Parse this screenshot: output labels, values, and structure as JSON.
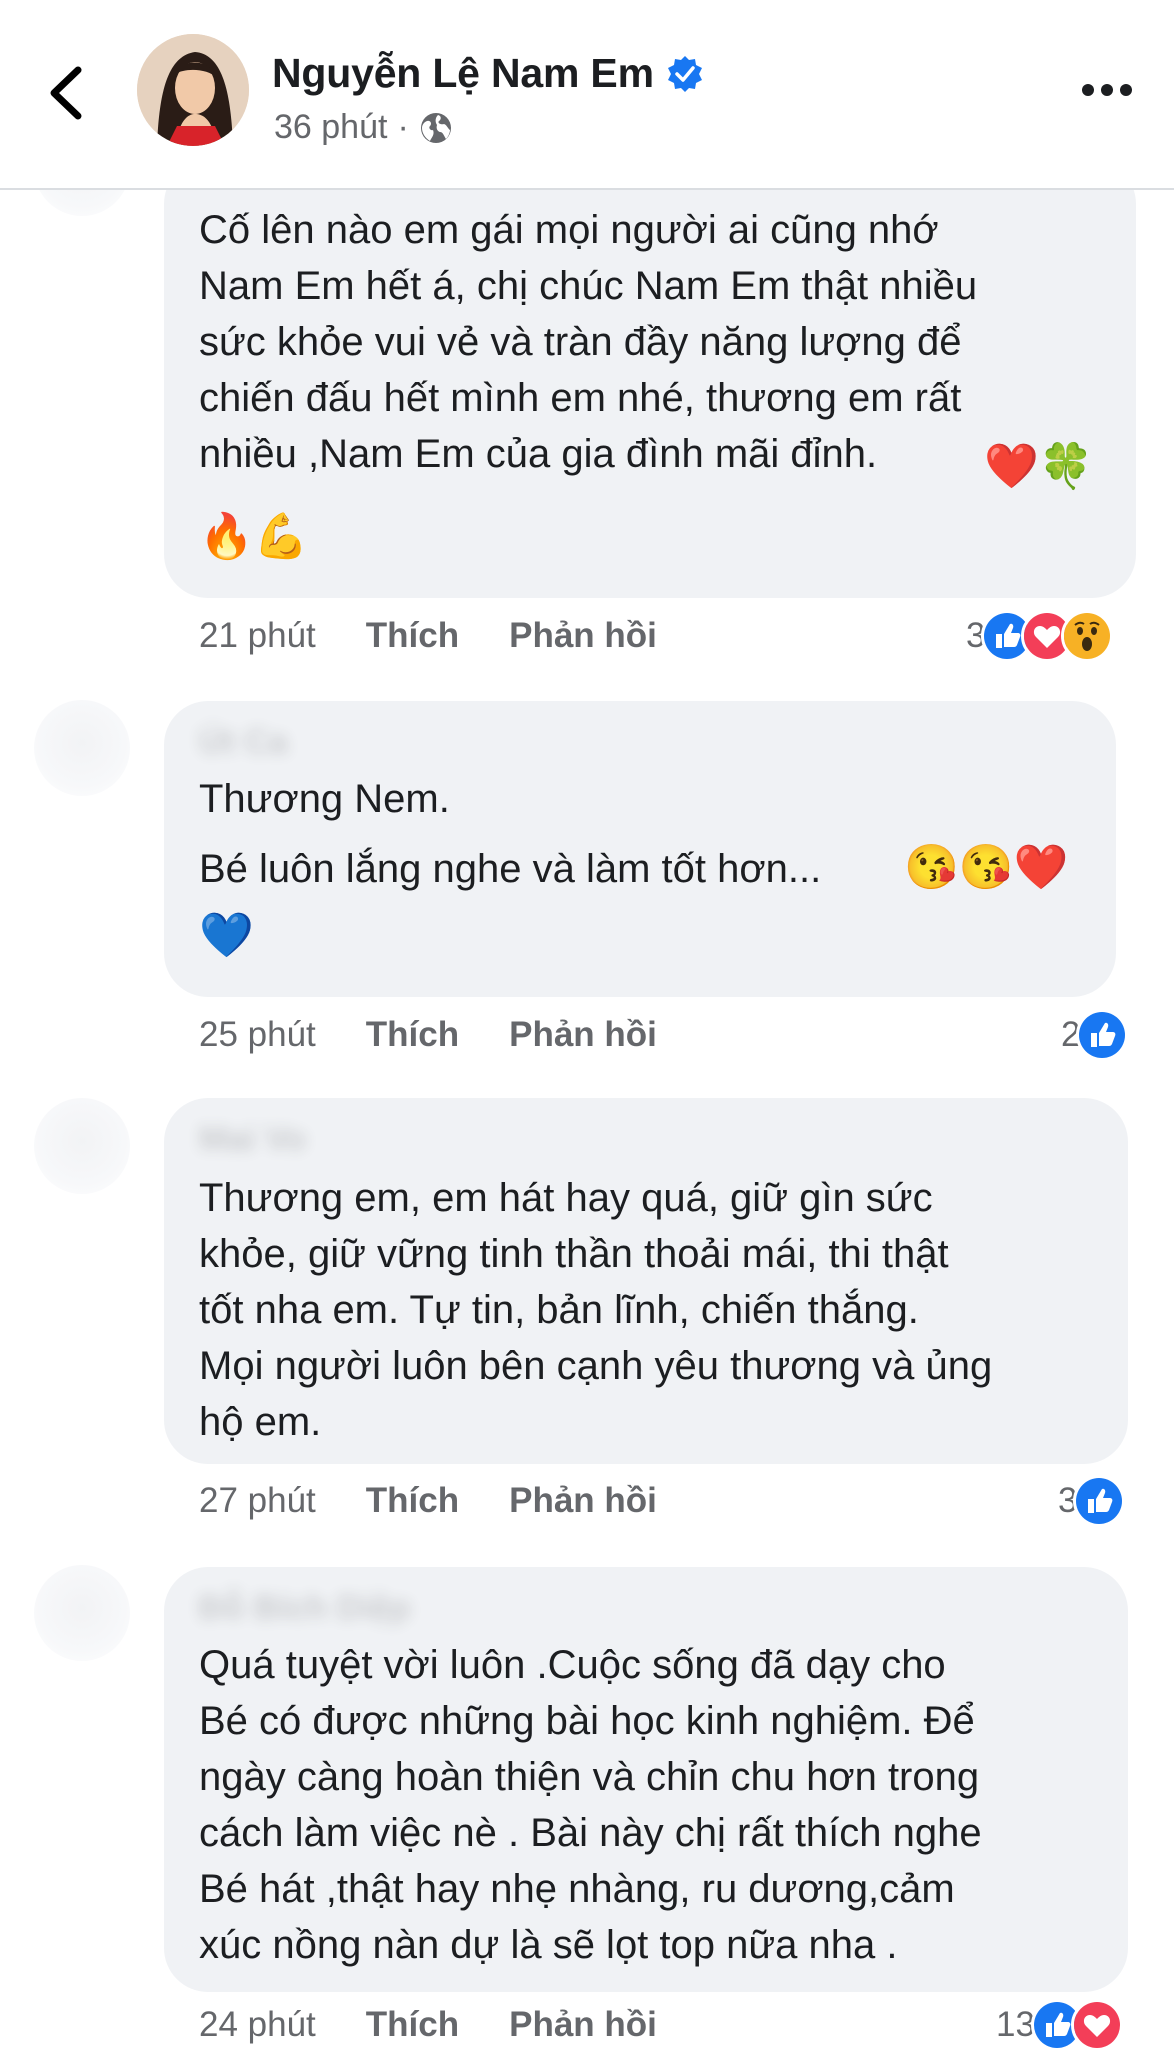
{
  "post": {
    "author": "Nguyễn Lệ Nam Em",
    "time": "36 phút",
    "separator": "·"
  },
  "icons": {
    "back": "chevron-left-icon",
    "verified": "verified-badge-icon",
    "privacy": "globe-icon",
    "more": "more-horizontal-icon"
  },
  "labels": {
    "like": "Thích",
    "reply": "Phản hồi"
  },
  "comments": [
    {
      "text_1": "Cố lên nào em gái mọi người ai cũng nhớ\nNam Em hết á, chị chúc Nam Em thật nhiều\nsức khỏe vui vẻ và tràn đầy năng lượng để\nchiến đấu hết mình em nhé, thương em rất\nnhiều ,Nam Em của gia đình mãi đỉnh.",
      "emoji_1": "❤️🍀",
      "emoji_2": "🔥💪",
      "time": "21 phút",
      "reaction_count": "3",
      "reactions": [
        "like",
        "love",
        "wow"
      ]
    },
    {
      "author": "Út Ca",
      "text_1": "Thương Nem.",
      "text_2": "Bé luôn lắng nghe và làm tốt hơn...",
      "emoji_1": "😘😘❤️",
      "emoji_2": "💙",
      "time": "25 phút",
      "reaction_count": "2",
      "reactions": [
        "like"
      ]
    },
    {
      "author": "Mai Vo",
      "text_1": "Thương em, em hát hay quá, giữ gìn sức\nkhỏe, giữ vững tinh thần thoải mái, thi thật\ntốt nha em. Tự tin, bản lĩnh, chiến thắng.\nMọi người luôn bên cạnh yêu thương và ủng\nhộ em.",
      "time": "27 phút",
      "reaction_count": "3",
      "reactions": [
        "like"
      ]
    },
    {
      "author": "Đỗ Bích Diệp",
      "text_1": "Quá tuyệt vời luôn .Cuộc sống đã dạy cho\nBé có được những bài học kinh nghiệm. Để\nngày càng hoàn thiện và chỉn chu hơn trong\ncách làm việc nè . Bài này chị rất thích nghe\nBé hát ,thật hay nhẹ nhàng, ru dương,cảm\nxúc nồng nàn dự là sẽ lọt top nữa nha .",
      "time": "24 phút",
      "reaction_count": "13",
      "reactions": [
        "like",
        "love"
      ]
    }
  ],
  "colors": {
    "bubble": "#f0f2f5",
    "meta_text": "#65676b",
    "like_blue": "#1877f2",
    "love_red": "#f33e58",
    "wow_yellow": "#f7b125"
  }
}
